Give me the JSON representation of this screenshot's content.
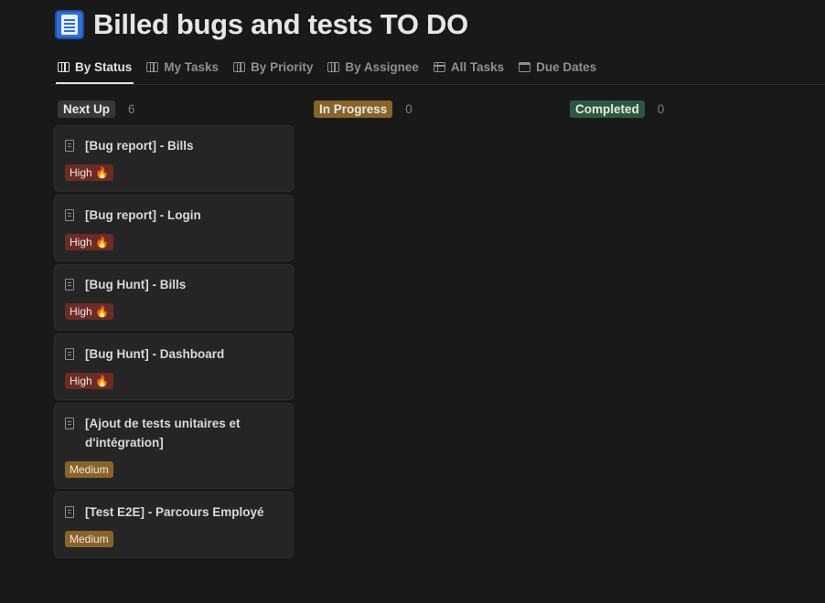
{
  "page": {
    "title": "Billed bugs and tests TO DO",
    "icon": "receipt-page-icon"
  },
  "tabs": [
    {
      "label": "By Status",
      "icon": "board-view-icon",
      "active": true
    },
    {
      "label": "My Tasks",
      "icon": "board-view-icon",
      "active": false
    },
    {
      "label": "By Priority",
      "icon": "board-view-icon",
      "active": false
    },
    {
      "label": "By Assignee",
      "icon": "board-view-icon",
      "active": false
    },
    {
      "label": "All Tasks",
      "icon": "table-view-icon",
      "active": false
    },
    {
      "label": "Due Dates",
      "icon": "calendar-view-icon",
      "active": false
    }
  ],
  "columns": [
    {
      "status": "Next Up",
      "count": "6",
      "color": "#373737"
    },
    {
      "status": "In Progress",
      "count": "0",
      "color": "#89632a"
    },
    {
      "status": "Completed",
      "count": "0",
      "color": "#2b593f"
    }
  ],
  "cards": [
    {
      "title": "[Bug report] - Bills",
      "priority": "High 🔥"
    },
    {
      "title": "[Bug report] - Login",
      "priority": "High 🔥"
    },
    {
      "title": "[Bug Hunt] - Bills",
      "priority": "High 🔥"
    },
    {
      "title": "[Bug Hunt] - Dashboard",
      "priority": "High 🔥"
    },
    {
      "title": "[Ajout de tests unitaires et d'intégration]",
      "priority": "Medium"
    },
    {
      "title": "[Test E2E] - Parcours Employé",
      "priority": "Medium"
    }
  ],
  "colors": {
    "background": "#191919",
    "card": "#252525",
    "high": "#6b2c26",
    "medium": "#89632a"
  }
}
